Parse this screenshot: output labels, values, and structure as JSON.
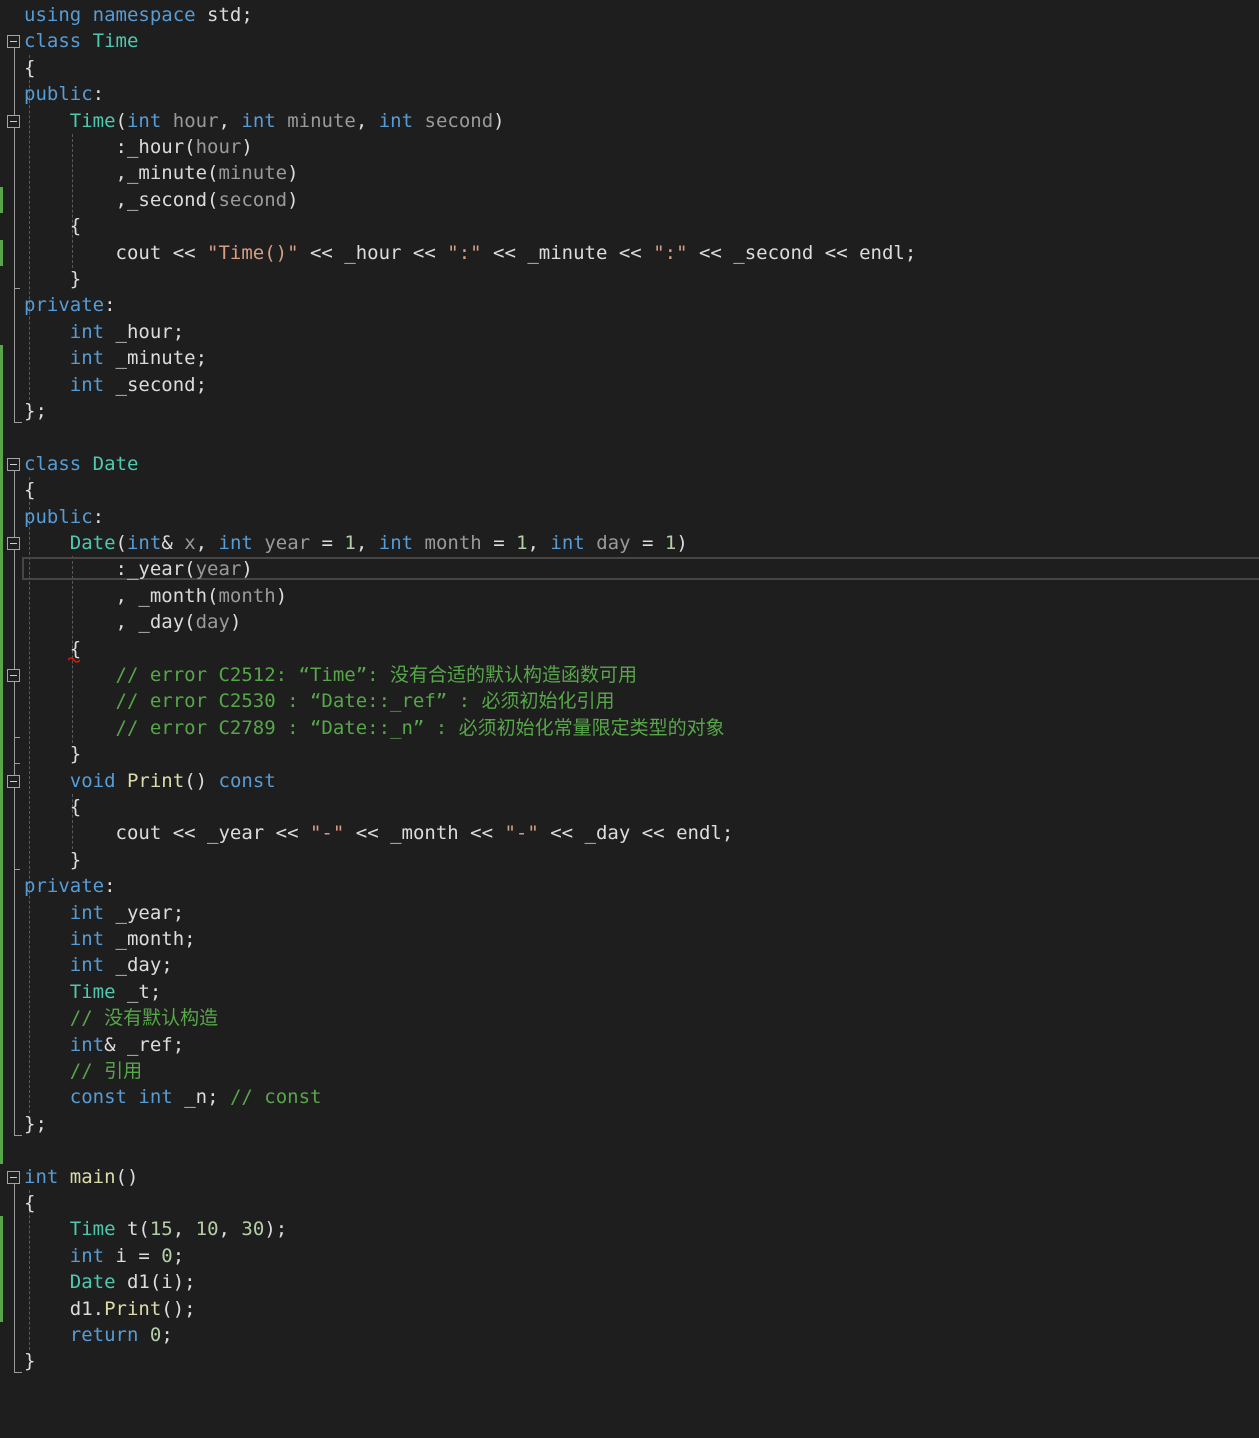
{
  "editor": {
    "lines": [
      [
        [
          "kw",
          "using"
        ],
        [
          "pl",
          " "
        ],
        [
          "kw",
          "namespace"
        ],
        [
          "pl",
          " std;"
        ]
      ],
      [
        [
          "kw",
          "class"
        ],
        [
          "pl",
          " "
        ],
        [
          "ty",
          "Time"
        ]
      ],
      [
        [
          "pl",
          "{"
        ]
      ],
      [
        [
          "kw",
          "public"
        ],
        [
          "pl",
          ":"
        ]
      ],
      [
        [
          "pl",
          "    "
        ],
        [
          "ty",
          "Time"
        ],
        [
          "pl",
          "("
        ],
        [
          "kw",
          "int"
        ],
        [
          "pl",
          " "
        ],
        [
          "pa",
          "hour"
        ],
        [
          "pl",
          ", "
        ],
        [
          "kw",
          "int"
        ],
        [
          "pl",
          " "
        ],
        [
          "pa",
          "minute"
        ],
        [
          "pl",
          ", "
        ],
        [
          "kw",
          "int"
        ],
        [
          "pl",
          " "
        ],
        [
          "pa",
          "second"
        ],
        [
          "pl",
          ")"
        ]
      ],
      [
        [
          "pl",
          "        :"
        ],
        [
          "mb",
          "_hour"
        ],
        [
          "pl",
          "("
        ],
        [
          "pa",
          "hour"
        ],
        [
          "pl",
          ")"
        ]
      ],
      [
        [
          "pl",
          "        ,"
        ],
        [
          "mb",
          "_minute"
        ],
        [
          "pl",
          "("
        ],
        [
          "pa",
          "minute"
        ],
        [
          "pl",
          ")"
        ]
      ],
      [
        [
          "pl",
          "        ,"
        ],
        [
          "mb",
          "_second"
        ],
        [
          "pl",
          "("
        ],
        [
          "pa",
          "second"
        ],
        [
          "pl",
          ")"
        ]
      ],
      [
        [
          "pl",
          "    {"
        ]
      ],
      [
        [
          "pl",
          "        cout << "
        ],
        [
          "st",
          "\"Time()\""
        ],
        [
          "pl",
          " << _hour << "
        ],
        [
          "st",
          "\":\""
        ],
        [
          "pl",
          " << _minute << "
        ],
        [
          "st",
          "\":\""
        ],
        [
          "pl",
          " << _second << endl;"
        ]
      ],
      [
        [
          "pl",
          "    }"
        ]
      ],
      [
        [
          "kw",
          "private"
        ],
        [
          "pl",
          ":"
        ]
      ],
      [
        [
          "pl",
          "    "
        ],
        [
          "kw",
          "int"
        ],
        [
          "pl",
          " _hour;"
        ]
      ],
      [
        [
          "pl",
          "    "
        ],
        [
          "kw",
          "int"
        ],
        [
          "pl",
          " _minute;"
        ]
      ],
      [
        [
          "pl",
          "    "
        ],
        [
          "kw",
          "int"
        ],
        [
          "pl",
          " _second;"
        ]
      ],
      [
        [
          "pl",
          "};"
        ]
      ],
      [],
      [
        [
          "kw",
          "class"
        ],
        [
          "pl",
          " "
        ],
        [
          "ty",
          "Date"
        ]
      ],
      [
        [
          "pl",
          "{"
        ]
      ],
      [
        [
          "kw",
          "public"
        ],
        [
          "pl",
          ":"
        ]
      ],
      [
        [
          "pl",
          "    "
        ],
        [
          "ty",
          "Date"
        ],
        [
          "pl",
          "("
        ],
        [
          "kw",
          "int"
        ],
        [
          "pl",
          "& "
        ],
        [
          "pa",
          "x"
        ],
        [
          "pl",
          ", "
        ],
        [
          "kw",
          "int"
        ],
        [
          "pl",
          " "
        ],
        [
          "pa",
          "year"
        ],
        [
          "pl",
          " = "
        ],
        [
          "nu",
          "1"
        ],
        [
          "pl",
          ", "
        ],
        [
          "kw",
          "int"
        ],
        [
          "pl",
          " "
        ],
        [
          "pa",
          "month"
        ],
        [
          "pl",
          " = "
        ],
        [
          "nu",
          "1"
        ],
        [
          "pl",
          ", "
        ],
        [
          "kw",
          "int"
        ],
        [
          "pl",
          " "
        ],
        [
          "pa",
          "day"
        ],
        [
          "pl",
          " = "
        ],
        [
          "nu",
          "1"
        ],
        [
          "pl",
          ")"
        ]
      ],
      [
        [
          "pl",
          "        :"
        ],
        [
          "mb",
          "_year"
        ],
        [
          "pl",
          "("
        ],
        [
          "pa",
          "year"
        ],
        [
          "pl",
          ")"
        ]
      ],
      [
        [
          "pl",
          "        , "
        ],
        [
          "mb",
          "_month"
        ],
        [
          "pl",
          "("
        ],
        [
          "pa",
          "month"
        ],
        [
          "pl",
          ")"
        ]
      ],
      [
        [
          "pl",
          "        , "
        ],
        [
          "mb",
          "_day"
        ],
        [
          "pl",
          "("
        ],
        [
          "pa",
          "day"
        ],
        [
          "pl",
          ")"
        ]
      ],
      [
        [
          "pl",
          "    {"
        ]
      ],
      [
        [
          "cm",
          "        // error C2512: “Time”: 没有合适的默认构造函数可用"
        ]
      ],
      [
        [
          "cm",
          "        // error C2530 : “Date::_ref” : 必须初始化引用"
        ]
      ],
      [
        [
          "cm",
          "        // error C2789 : “Date::_n” : 必须初始化常量限定类型的对象"
        ]
      ],
      [
        [
          "pl",
          "    }"
        ]
      ],
      [
        [
          "pl",
          "    "
        ],
        [
          "kw",
          "void"
        ],
        [
          "pl",
          " "
        ],
        [
          "fn",
          "Print"
        ],
        [
          "pl",
          "() "
        ],
        [
          "kw",
          "const"
        ]
      ],
      [
        [
          "pl",
          "    {"
        ]
      ],
      [
        [
          "pl",
          "        cout << _year << "
        ],
        [
          "st",
          "\"-\""
        ],
        [
          "pl",
          " << _month << "
        ],
        [
          "st",
          "\"-\""
        ],
        [
          "pl",
          " << _day << endl;"
        ]
      ],
      [
        [
          "pl",
          "    }"
        ]
      ],
      [
        [
          "kw",
          "private"
        ],
        [
          "pl",
          ":"
        ]
      ],
      [
        [
          "pl",
          "    "
        ],
        [
          "kw",
          "int"
        ],
        [
          "pl",
          " _year;"
        ]
      ],
      [
        [
          "pl",
          "    "
        ],
        [
          "kw",
          "int"
        ],
        [
          "pl",
          " _month;"
        ]
      ],
      [
        [
          "pl",
          "    "
        ],
        [
          "kw",
          "int"
        ],
        [
          "pl",
          " _day;"
        ]
      ],
      [
        [
          "pl",
          "    "
        ],
        [
          "ty",
          "Time"
        ],
        [
          "pl",
          " _t;"
        ]
      ],
      [
        [
          "cm",
          "    // 没有默认构造"
        ]
      ],
      [
        [
          "pl",
          "    "
        ],
        [
          "kw",
          "int"
        ],
        [
          "pl",
          "& _ref;"
        ]
      ],
      [
        [
          "cm",
          "    // 引用"
        ]
      ],
      [
        [
          "pl",
          "    "
        ],
        [
          "kw",
          "const"
        ],
        [
          "pl",
          " "
        ],
        [
          "kw",
          "int"
        ],
        [
          "pl",
          " _n; "
        ],
        [
          "cm",
          "// const"
        ]
      ],
      [
        [
          "pl",
          "};"
        ]
      ],
      [],
      [
        [
          "kw",
          "int"
        ],
        [
          "pl",
          " "
        ],
        [
          "fn",
          "main"
        ],
        [
          "pl",
          "()"
        ]
      ],
      [
        [
          "pl",
          "{"
        ]
      ],
      [
        [
          "pl",
          "    "
        ],
        [
          "ty",
          "Time"
        ],
        [
          "pl",
          " t("
        ],
        [
          "nu",
          "15"
        ],
        [
          "pl",
          ", "
        ],
        [
          "nu",
          "10"
        ],
        [
          "pl",
          ", "
        ],
        [
          "nu",
          "30"
        ],
        [
          "pl",
          ");"
        ]
      ],
      [
        [
          "pl",
          "    "
        ],
        [
          "kw",
          "int"
        ],
        [
          "pl",
          " i = "
        ],
        [
          "nu",
          "0"
        ],
        [
          "pl",
          ";"
        ]
      ],
      [
        [
          "pl",
          "    "
        ],
        [
          "ty",
          "Date"
        ],
        [
          "pl",
          " d1(i);"
        ]
      ],
      [
        [
          "pl",
          "    d1."
        ],
        [
          "fn",
          "Print"
        ],
        [
          "pl",
          "();"
        ]
      ],
      [
        [
          "pl",
          "    "
        ],
        [
          "kw",
          "return"
        ],
        [
          "pl",
          " "
        ],
        [
          "nu",
          "0"
        ],
        [
          "pl",
          ";"
        ]
      ],
      [
        [
          "pl",
          "}"
        ]
      ]
    ],
    "current_line": 21,
    "fold_lines": [
      1,
      4,
      17,
      20,
      25,
      29,
      44
    ],
    "changed_ranges": [
      [
        7,
        7
      ],
      [
        9,
        9
      ],
      [
        13,
        16
      ],
      [
        17,
        43
      ],
      [
        46,
        49
      ]
    ],
    "squiggle_line": 24
  }
}
